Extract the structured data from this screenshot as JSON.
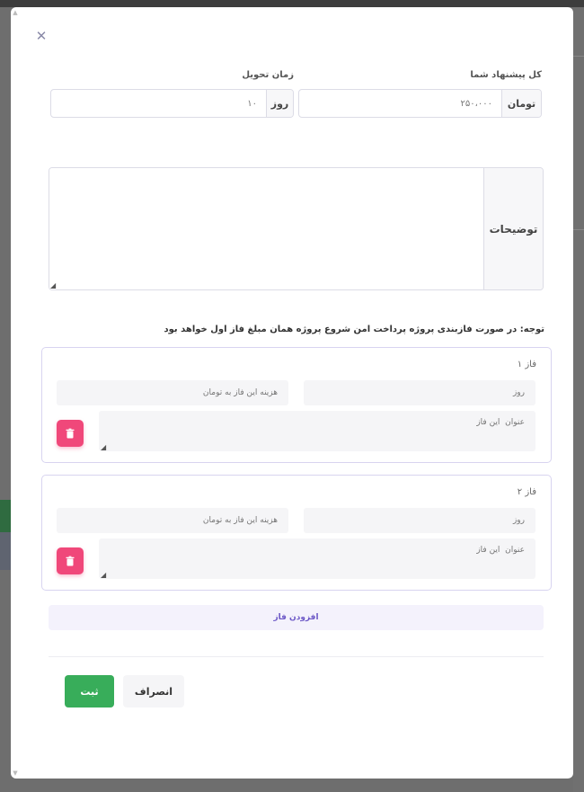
{
  "modal": {
    "close_icon": "close-icon",
    "offer": {
      "label": "کل پیشنهاد شما",
      "value": "۲۵۰،۰۰۰",
      "unit": "تومان"
    },
    "delivery": {
      "label": "زمان تحویل",
      "value": "۱۰",
      "unit": "روز"
    },
    "description": {
      "label": "توضیحات",
      "value": ""
    },
    "note": "توجه: در صورت فازبندی پروژه پرداخت امن شروع پروژه همان مبلغ فاز اول خواهد بود",
    "phases": [
      {
        "title": "فاز ۱",
        "days_placeholder": "روز",
        "cost_placeholder": "هزینه این فاز به تومان",
        "title_placeholder": "عنوان  این فاز",
        "delete_icon": "trash-icon"
      },
      {
        "title": "فاز ۲",
        "days_placeholder": "روز",
        "cost_placeholder": "هزینه این فاز به تومان",
        "title_placeholder": "عنوان  این فاز",
        "delete_icon": "trash-icon"
      }
    ],
    "add_phase_label": "افزودن فاز",
    "cancel_label": "انصراف",
    "submit_label": "ثبت"
  },
  "colors": {
    "submit": "#38ad5a",
    "delete": "#f0487a",
    "accent": "#6d59c7",
    "background_green": "#2f6b40"
  }
}
